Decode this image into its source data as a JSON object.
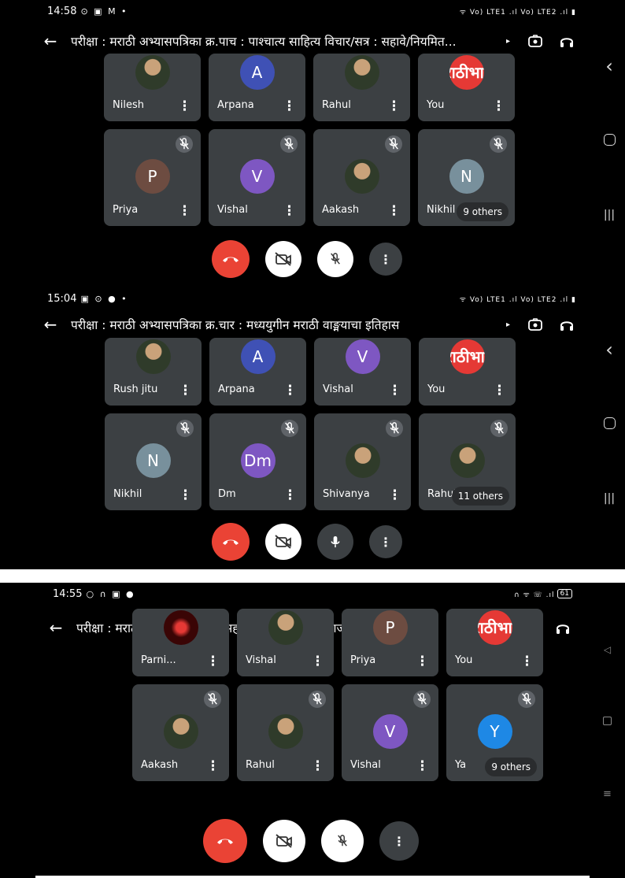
{
  "colors": {
    "end_call": "#ea4335",
    "tile_bg": "#3c4043",
    "chip_bg": "#5f6368"
  },
  "icons": {
    "back": "←",
    "headphones": "🎧",
    "switch_camera": "switch-camera-icon",
    "end_call": "phone-hangup-icon",
    "camera_off": "camera-off-icon",
    "mic_off": "mic-off-icon",
    "mic_on": "mic-icon",
    "more": "⋮",
    "nav_back": "‹",
    "nav_home": "▢",
    "nav_recents": "|||",
    "title_chevron": "▸"
  },
  "brand_avatar": {
    "line1": "मराठी",
    "line2": "भाषा"
  },
  "screenshots": [
    {
      "status": {
        "time": "14:58",
        "left_icons": "⊙ ▣ M •",
        "right_icons": "ᯤ Vo) LTE1 .ıl Vo) LTE2 .ıl ▮"
      },
      "title": "परीक्षा : मराठी अभ्यासपत्रिका क्र.पाच : पाश्चात्य साहित्य विचार/सत्र : सहावे/नियमित...",
      "row1": [
        {
          "name": "Nilesh",
          "avatar": "photo"
        },
        {
          "name": "Arpana",
          "avatar": "A",
          "color": "#3f51b5"
        },
        {
          "name": "Rahul",
          "avatar": "photo"
        },
        {
          "name": "You",
          "avatar": "brand"
        }
      ],
      "row2": [
        {
          "name": "Priya",
          "avatar": "P",
          "color": "#6d4c41",
          "muted": true
        },
        {
          "name": "Vishal",
          "avatar": "V",
          "color": "#7e57c2",
          "muted": true
        },
        {
          "name": "Aakash",
          "avatar": "photo",
          "muted": true
        },
        {
          "name": "Nikhil",
          "avatar": "N",
          "color": "#78909c",
          "muted": true,
          "others": "9 others"
        }
      ],
      "mic_muted": true
    },
    {
      "status": {
        "time": "15:04",
        "left_icons": "▣ ⊙ ● •",
        "right_icons": "ᯤ Vo) LTE1 .ıl Vo) LTE2 .ıl ▮"
      },
      "title": "परीक्षा : मराठी अभ्यासपत्रिका क्र.चार : मध्ययुगीन मराठी वाङ्मयाचा इतिहास",
      "row1": [
        {
          "name": "Rush jitu",
          "avatar": "photo"
        },
        {
          "name": "Arpana",
          "avatar": "A",
          "color": "#3f51b5"
        },
        {
          "name": "Vishal",
          "avatar": "V",
          "color": "#7e57c2"
        },
        {
          "name": "You",
          "avatar": "brand"
        }
      ],
      "row2": [
        {
          "name": "Nikhil",
          "avatar": "N",
          "color": "#78909c",
          "muted": true
        },
        {
          "name": "Dm",
          "avatar": "Dm",
          "color": "#7e57c2",
          "muted": true
        },
        {
          "name": "Shivanya",
          "avatar": "photo",
          "muted": true
        },
        {
          "name": "Rahul",
          "avatar": "photo",
          "muted": true,
          "others": "11 others"
        }
      ],
      "mic_muted": false
    },
    {
      "status": {
        "time": "14:55",
        "left_icons": "○ ∩ ▣ ●",
        "right_icons": "∩ ᯤ ☏ .ıl",
        "battery": "61"
      },
      "title": "परीक्षा : मराठी अभ्यासपत्रिका क्र.सहा : साहित्य आणि समाज/सत्र : सहावे/नि...",
      "row1": [
        {
          "name": "Parni...",
          "avatar": "photo-red"
        },
        {
          "name": "Vishal",
          "avatar": "photo"
        },
        {
          "name": "Priya",
          "avatar": "P",
          "color": "#6d4c41"
        },
        {
          "name": "You",
          "avatar": "brand"
        }
      ],
      "row2": [
        {
          "name": "Aakash",
          "avatar": "photo",
          "muted": true
        },
        {
          "name": "Rahul",
          "avatar": "photo",
          "muted": true
        },
        {
          "name": "Vishal",
          "avatar": "V",
          "color": "#7e57c2",
          "muted": true
        },
        {
          "name": "Ya",
          "avatar": "Y",
          "color": "#1e88e5",
          "muted": true,
          "others": "9 others"
        }
      ],
      "mic_muted": true
    }
  ]
}
